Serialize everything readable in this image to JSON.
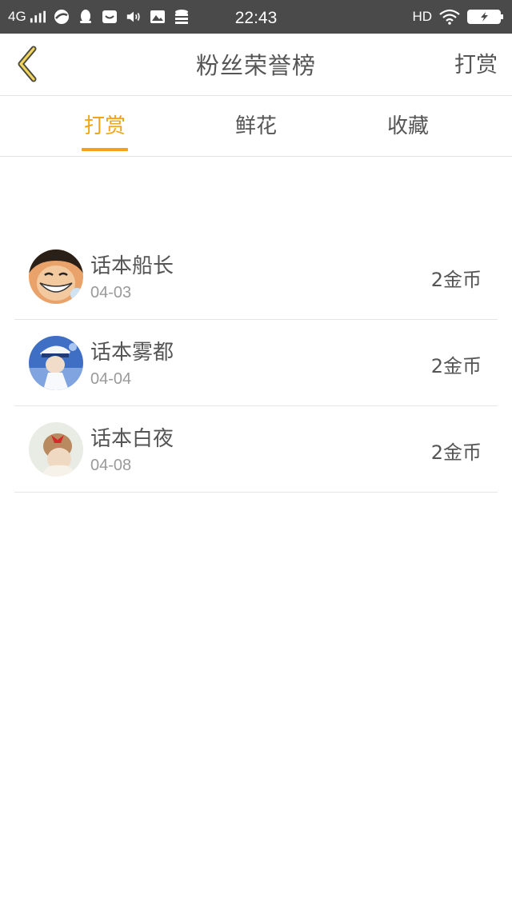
{
  "statusbar": {
    "network": "4G",
    "time": "22:43",
    "hd": "HD"
  },
  "header": {
    "title": "粉丝荣誉榜",
    "action": "打赏"
  },
  "tabs": [
    {
      "label": "打赏",
      "active": true
    },
    {
      "label": "鲜花",
      "active": false
    },
    {
      "label": "收藏",
      "active": false
    }
  ],
  "colors": {
    "accent": "#f0a31c",
    "statusbar": "#4a4a4a"
  },
  "items": [
    {
      "name": "话本船长",
      "date": "04-03",
      "amount": "2金币"
    },
    {
      "name": "话本雾都",
      "date": "04-04",
      "amount": "2金币"
    },
    {
      "name": "话本白夜",
      "date": "04-08",
      "amount": "2金币"
    }
  ]
}
